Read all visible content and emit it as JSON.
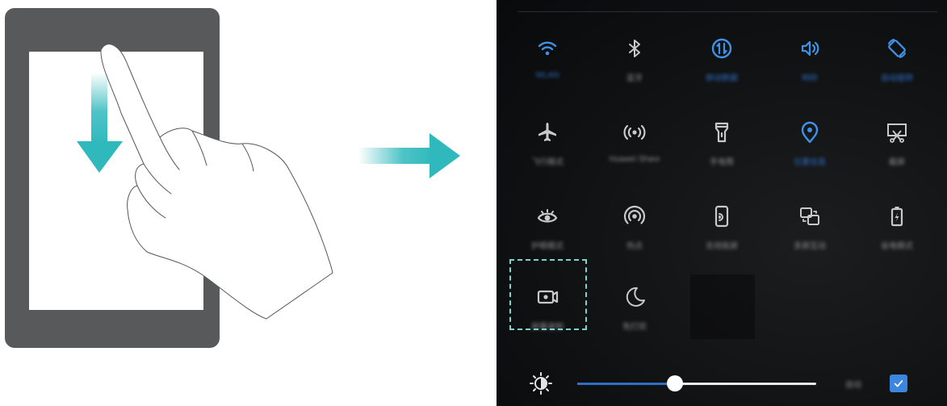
{
  "quick_settings": {
    "tiles": [
      {
        "name": "wifi",
        "icon": "wifi-icon",
        "label": "WLAN",
        "active": true
      },
      {
        "name": "bluetooth",
        "icon": "bluetooth-icon",
        "label": "蓝牙",
        "active": false
      },
      {
        "name": "mobile-data",
        "icon": "mobile-data-icon",
        "label": "移动数据",
        "active": true
      },
      {
        "name": "sound",
        "icon": "speaker-icon",
        "label": "响铃",
        "active": true
      },
      {
        "name": "auto-rotate",
        "icon": "rotate-icon",
        "label": "自动旋转",
        "active": true
      },
      {
        "name": "airplane-mode",
        "icon": "airplane-icon",
        "label": "飞行模式",
        "active": false
      },
      {
        "name": "huawei-share",
        "icon": "share-broadcast-icon",
        "label": "Huawei Share",
        "active": false
      },
      {
        "name": "flashlight",
        "icon": "flashlight-icon",
        "label": "手电筒",
        "active": false
      },
      {
        "name": "location",
        "icon": "location-pin-icon",
        "label": "位置信息",
        "active": true
      },
      {
        "name": "screenshot",
        "icon": "screenshot-icon",
        "label": "截屏",
        "active": false
      },
      {
        "name": "eye-comfort",
        "icon": "eye-icon",
        "label": "护眼模式",
        "active": false
      },
      {
        "name": "hotspot",
        "icon": "hotspot-icon",
        "label": "热点",
        "active": false
      },
      {
        "name": "screen-mirroring",
        "icon": "phone-cast-icon",
        "label": "无线投屏",
        "active": false
      },
      {
        "name": "multi-screen",
        "icon": "multi-screen-icon",
        "label": "多屏互动",
        "active": false
      },
      {
        "name": "power-saving",
        "icon": "battery-icon",
        "label": "省电模式",
        "active": false
      },
      {
        "name": "screen-recorder",
        "icon": "screen-recorder-icon",
        "label": "屏幕录制",
        "active": false
      },
      {
        "name": "do-not-disturb",
        "icon": "moon-icon",
        "label": "免打扰",
        "active": false
      }
    ],
    "highlighted_tile": "screen-recorder"
  },
  "brightness": {
    "icon": "brightness-icon",
    "level": 0.41,
    "auto_label": "自动",
    "auto_checked": true
  },
  "colors": {
    "accent": "#2f6fc6",
    "accent_icon": "#3f92e8",
    "icon_gray": "#c7c9cb",
    "guide_teal": "#2fb9bd",
    "highlight_border": "#7bd3d3"
  }
}
